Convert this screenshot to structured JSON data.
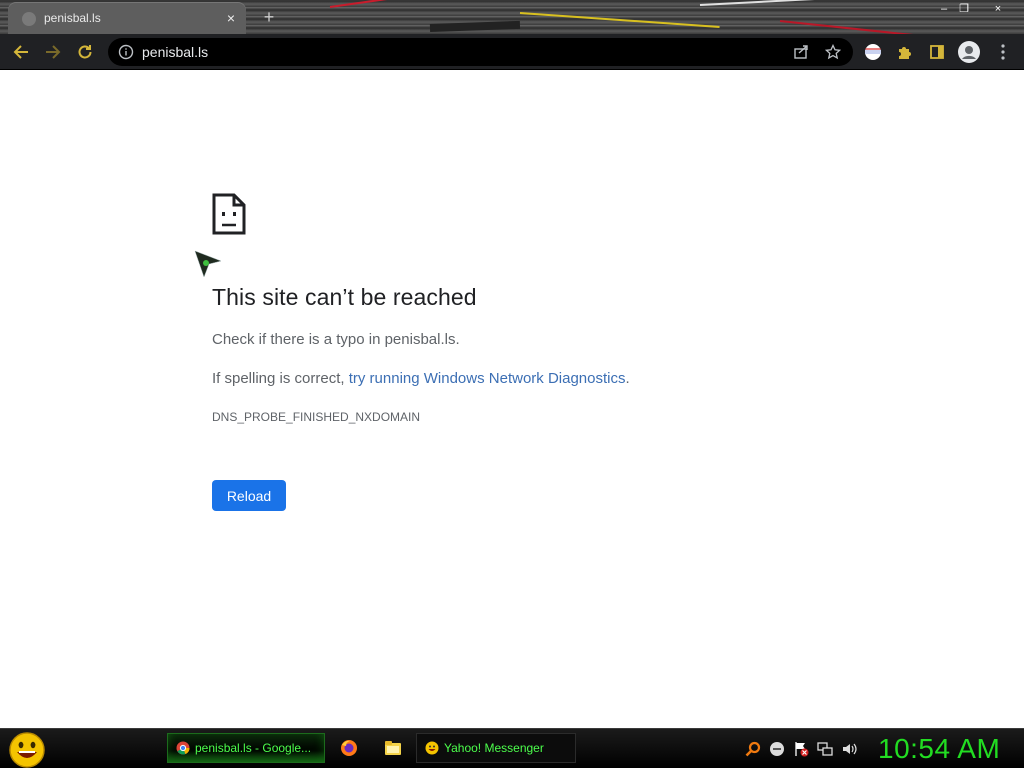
{
  "browser": {
    "tab": {
      "title": "penisbal.ls",
      "close_glyph": "×"
    },
    "new_tab_glyph": "+",
    "window_controls": [
      "–",
      "❐",
      "×"
    ],
    "url": "penisbal.ls"
  },
  "error_page": {
    "title": "This site can’t be reached",
    "line1": "Check if there is a typo in penisbal.ls.",
    "line2_prefix": "If spelling is correct, ",
    "line2_link": "try running Windows Network Diagnostics",
    "line2_suffix": ".",
    "error_code": "DNS_PROBE_FINISHED_NXDOMAIN",
    "reload_label": "Reload"
  },
  "taskbar": {
    "tasks": [
      {
        "label": "penisbal.ls - Google...",
        "icon": "chrome-icon",
        "active": true
      },
      {
        "label": "Yahoo! Messenger",
        "icon": "yahoo-messenger-icon",
        "active": false
      }
    ],
    "quicklaunch": [
      "firefox-icon",
      "folder-icon"
    ],
    "tray": [
      "search-icon",
      "messenger-status-icon",
      "flag-icon",
      "network-icon",
      "volume-icon"
    ],
    "clock": "10:54 AM"
  },
  "colors": {
    "accent": "#1a73e8",
    "link": "#3c6fb4",
    "clock": "#22dd22",
    "taskbar_text": "#4cff4c"
  }
}
